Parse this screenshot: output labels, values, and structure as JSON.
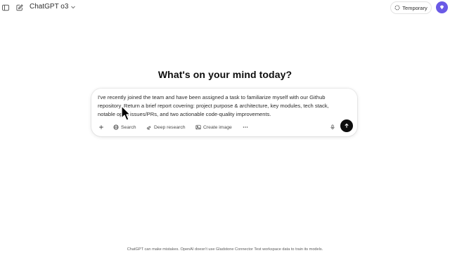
{
  "header": {
    "model_name": "ChatGPT o3",
    "temporary_label": "Temporary",
    "icons": [
      "sidebar-toggle-icon",
      "new-chat-icon",
      "chevron-down-icon",
      "dashed-circle-icon",
      "avatar-diamond-icon"
    ]
  },
  "main": {
    "headline": "What's on your mind today?"
  },
  "composer": {
    "prompt_text": "I've recently joined the team and have been assigned a task to familiarize myself with our Github repository. Return a brief report covering: project purpose & architecture, key modules, tech stack, notable open issues/PRs, and two actionable code-quality improvements.",
    "tools": {
      "search_label": "Search",
      "deep_research_label": "Deep research",
      "create_image_label": "Create image"
    },
    "icons": [
      "plus-icon",
      "globe-icon",
      "telescope-icon",
      "image-icon",
      "more-icon",
      "mic-icon",
      "arrow-up-icon"
    ]
  },
  "footer": {
    "disclaimer": "ChatGPT can make mistakes. OpenAI doesn't use Gladstone Connector Test workspace data to train its models."
  },
  "colors": {
    "background": "#ffffff",
    "text": "#0d0d0d",
    "muted_text": "#4b4b4b",
    "send_button": "#0d0d0d",
    "avatar": "#6a5ae6"
  }
}
